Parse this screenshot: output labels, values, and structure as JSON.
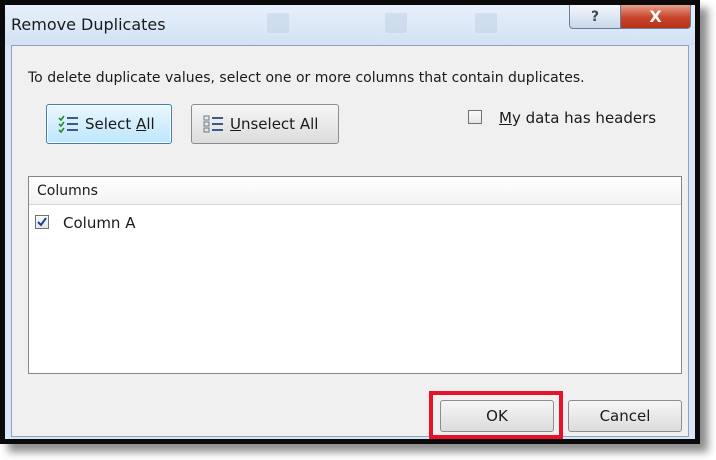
{
  "window": {
    "title": "Remove Duplicates",
    "help_button": "?",
    "close_button": "X"
  },
  "dialog": {
    "instructions": "To delete duplicate values, select one or more columns that contain duplicates.",
    "select_all": {
      "mnemonic": "A",
      "before": "Select ",
      "after": "ll"
    },
    "unselect_all": {
      "mnemonic": "U",
      "before": "",
      "after": "nselect All"
    },
    "headers_checkbox": {
      "mnemonic": "M",
      "before": "",
      "after": "y data has headers",
      "checked": false
    }
  },
  "columns": {
    "header": "Columns",
    "items": [
      {
        "label": "Column A",
        "checked": true
      }
    ]
  },
  "footer": {
    "ok_label": "OK",
    "cancel_label": "Cancel"
  },
  "colors": {
    "highlight": "#e8102a",
    "close_button": "#c7432a",
    "dialog_background": "#f0f0f0"
  }
}
